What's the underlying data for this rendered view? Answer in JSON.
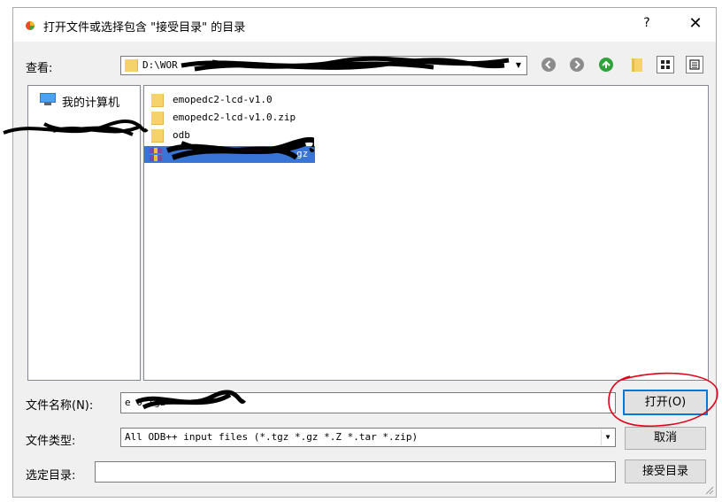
{
  "window": {
    "title": "打开文件或选择包含 \"接受目录\" 的目录",
    "help_label": "?",
    "close_label": "✕"
  },
  "lookin": {
    "label": "查看:",
    "path": "D:\\WOR"
  },
  "sidebar": {
    "items": [
      {
        "label": "我的计算机",
        "icon": "computer-icon"
      }
    ]
  },
  "files": [
    {
      "name": "emopedc2-lcd-v1.0",
      "icon": "folder-icon",
      "selected": false
    },
    {
      "name": "emopedc2-lcd-v1.0.zip",
      "icon": "folder-icon",
      "selected": false
    },
    {
      "name": "odb",
      "icon": "folder-icon",
      "selected": false
    },
    {
      "name": "gz",
      "icon": "archive-icon",
      "selected": true
    }
  ],
  "filename": {
    "label": "文件名称(N):",
    "value": "e            0.tgz"
  },
  "filetype": {
    "label": "文件类型:",
    "value": "All ODB++ input files (*.tgz *.gz *.Z *.tar *.zip)"
  },
  "selected_dir": {
    "label": "选定目录:",
    "value": ""
  },
  "buttons": {
    "open": "打开(O)",
    "cancel": "取消",
    "accept_dir": "接受目录"
  },
  "colors": {
    "selection": "#3875d7",
    "annotation": "#e0001a",
    "folder": "#f6d36a"
  }
}
